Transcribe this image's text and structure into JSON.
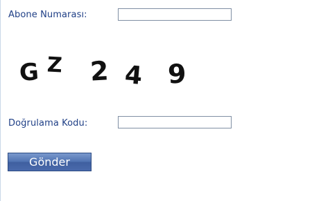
{
  "form": {
    "subscriber_label": "Abone Numarası:",
    "subscriber_value": "",
    "verification_label": "Doğrulama Kodu:",
    "verification_value": "",
    "submit_label": "Gönder"
  },
  "captcha": {
    "characters": [
      "G",
      "Z",
      "2",
      "4",
      "9"
    ]
  },
  "colors": {
    "label": "#1f3f86",
    "button": "#4a6aac",
    "input_border": "#7f8ea3"
  }
}
